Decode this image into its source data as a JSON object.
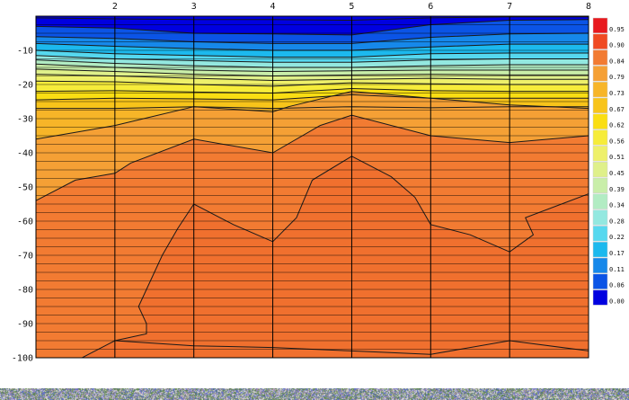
{
  "chart_data": {
    "type": "heatmap",
    "title": "",
    "xlabel": "",
    "ylabel": "",
    "x_ticks": [
      2,
      3,
      4,
      5,
      6,
      7,
      8
    ],
    "y_ticks": [
      -10,
      -20,
      -30,
      -40,
      -50,
      -60,
      -70,
      -80,
      -90,
      -100
    ],
    "xlim": [
      1,
      8
    ],
    "ylim": [
      -100,
      0
    ],
    "grid": true,
    "colorbar": {
      "position": "right",
      "labels": [
        "0.95",
        "0.90",
        "0.84",
        "0.79",
        "0.73",
        "0.67",
        "0.62",
        "0.56",
        "0.51",
        "0.45",
        "0.39",
        "0.34",
        "0.28",
        "0.22",
        "0.17",
        "0.11",
        "0.06",
        "0.00"
      ],
      "colors": [
        "#e8191e",
        "#f04a22",
        "#f27b32",
        "#f5a035",
        "#f7b528",
        "#f8c41a",
        "#fade13",
        "#f6ec3a",
        "#eef06a",
        "#dff08a",
        "#c9eea9",
        "#b2ecc3",
        "#93e8e0",
        "#56d8ef",
        "#1cb9ee",
        "#1688ea",
        "#0b54e6",
        "#0000e0"
      ]
    },
    "bands": [
      {
        "level": 0.0,
        "color": "#0000e0",
        "boundary": [
          [
            1,
            -0.5
          ],
          [
            2,
            -0.8
          ],
          [
            3,
            -1.0
          ],
          [
            4,
            -1.0
          ],
          [
            5,
            -1.2
          ],
          [
            6,
            -0.5
          ],
          [
            7,
            -0.2
          ],
          [
            8,
            -0.2
          ]
        ]
      },
      {
        "level": 0.06,
        "color": "#0b54e6",
        "boundary": [
          [
            1,
            -3
          ],
          [
            2,
            -3.5
          ],
          [
            3,
            -5
          ],
          [
            4,
            -5.2
          ],
          [
            5,
            -5.5
          ],
          [
            6,
            -2.5
          ],
          [
            7,
            -1.2
          ],
          [
            8,
            -1.0
          ]
        ]
      },
      {
        "level": 0.11,
        "color": "#1688ea",
        "boundary": [
          [
            1,
            -6
          ],
          [
            2,
            -6.5
          ],
          [
            3,
            -7.5
          ],
          [
            4,
            -8
          ],
          [
            5,
            -8
          ],
          [
            6,
            -6.2
          ],
          [
            7,
            -5.2
          ],
          [
            8,
            -5.0
          ]
        ]
      },
      {
        "level": 0.17,
        "color": "#1cb9ee",
        "boundary": [
          [
            1,
            -8
          ],
          [
            2,
            -8.8
          ],
          [
            3,
            -9.5
          ],
          [
            4,
            -10
          ],
          [
            5,
            -10
          ],
          [
            6,
            -9
          ],
          [
            7,
            -8.2
          ],
          [
            8,
            -8.2
          ]
        ]
      },
      {
        "level": 0.22,
        "color": "#56d8ef",
        "boundary": [
          [
            1,
            -10
          ],
          [
            2,
            -11
          ],
          [
            3,
            -11.5
          ],
          [
            4,
            -12
          ],
          [
            5,
            -12
          ],
          [
            6,
            -11
          ],
          [
            7,
            -10.8
          ],
          [
            8,
            -10.8
          ]
        ]
      },
      {
        "level": 0.28,
        "color": "#93e8e0",
        "boundary": [
          [
            1,
            -11.5
          ],
          [
            2,
            -12.5
          ],
          [
            3,
            -13
          ],
          [
            4,
            -13.5
          ],
          [
            5,
            -13.5
          ],
          [
            6,
            -12.8
          ],
          [
            7,
            -12.5
          ],
          [
            8,
            -12.5
          ]
        ]
      },
      {
        "level": 0.34,
        "color": "#b2ecc3",
        "boundary": [
          [
            1,
            -12.8
          ],
          [
            2,
            -13.8
          ],
          [
            3,
            -14.5
          ],
          [
            4,
            -15
          ],
          [
            5,
            -15
          ],
          [
            6,
            -14.5
          ],
          [
            7,
            -14.2
          ],
          [
            8,
            -14.2
          ]
        ]
      },
      {
        "level": 0.39,
        "color": "#c9eea9",
        "boundary": [
          [
            1,
            -14
          ],
          [
            2,
            -15
          ],
          [
            3,
            -15.8
          ],
          [
            4,
            -16.2
          ],
          [
            5,
            -16
          ],
          [
            6,
            -15.8
          ],
          [
            7,
            -15.8
          ],
          [
            8,
            -15.8
          ]
        ]
      },
      {
        "level": 0.45,
        "color": "#dff08a",
        "boundary": [
          [
            1,
            -15.5
          ],
          [
            2,
            -16.2
          ],
          [
            3,
            -17
          ],
          [
            4,
            -17.5
          ],
          [
            5,
            -17.2
          ],
          [
            6,
            -17
          ],
          [
            7,
            -17.2
          ],
          [
            8,
            -17.2
          ]
        ]
      },
      {
        "level": 0.51,
        "color": "#eef06a",
        "boundary": [
          [
            1,
            -17
          ],
          [
            2,
            -17.5
          ],
          [
            3,
            -18.2
          ],
          [
            4,
            -18.8
          ],
          [
            5,
            -18.5
          ],
          [
            6,
            -18.2
          ],
          [
            7,
            -18.5
          ],
          [
            8,
            -18.5
          ]
        ]
      },
      {
        "level": 0.56,
        "color": "#f6ec3a",
        "boundary": [
          [
            1,
            -19
          ],
          [
            2,
            -19.2
          ],
          [
            3,
            -20
          ],
          [
            4,
            -20.5
          ],
          [
            5,
            -19.5
          ],
          [
            6,
            -19.8
          ],
          [
            7,
            -20
          ],
          [
            8,
            -20
          ]
        ]
      },
      {
        "level": 0.62,
        "color": "#fade13",
        "boundary": [
          [
            1,
            -22
          ],
          [
            2,
            -21.8
          ],
          [
            3,
            -22.2
          ],
          [
            4,
            -22.5
          ],
          [
            5,
            -21.2
          ],
          [
            6,
            -21.8
          ],
          [
            7,
            -22
          ],
          [
            8,
            -22
          ]
        ]
      },
      {
        "level": 0.67,
        "color": "#f8c41a",
        "boundary": [
          [
            1,
            -24.5
          ],
          [
            2,
            -24
          ],
          [
            3,
            -24.2
          ],
          [
            4,
            -24.5
          ],
          [
            5,
            -23
          ],
          [
            6,
            -24
          ],
          [
            7,
            -24
          ],
          [
            8,
            -24
          ]
        ]
      },
      {
        "level": 0.73,
        "color": "#f7b528",
        "boundary": [
          [
            1,
            -27
          ],
          [
            2,
            -27
          ],
          [
            3,
            -26.5
          ],
          [
            4,
            -27
          ],
          [
            5,
            -26.5
          ],
          [
            6,
            -26.8
          ],
          [
            7,
            -26.5
          ],
          [
            8,
            -26.5
          ]
        ]
      },
      {
        "level": 0.79,
        "color": "#f5a035",
        "boundary": [
          [
            1,
            -36
          ],
          [
            1.5,
            -34
          ],
          [
            2,
            -32
          ],
          [
            3,
            -26.5
          ],
          [
            4,
            -28
          ],
          [
            4.2,
            -26.5
          ],
          [
            5,
            -22
          ],
          [
            6,
            -24
          ],
          [
            7,
            -26
          ],
          [
            8,
            -27
          ]
        ]
      },
      {
        "level": 0.84,
        "color": "#f27b32",
        "boundary": [
          [
            1,
            -54
          ],
          [
            1.5,
            -48
          ],
          [
            2,
            -46
          ],
          [
            2.2,
            -43
          ],
          [
            3,
            -36
          ],
          [
            4,
            -40
          ],
          [
            4.6,
            -32
          ],
          [
            5,
            -29
          ],
          [
            6,
            -35
          ],
          [
            7,
            -37
          ],
          [
            8,
            -35
          ]
        ]
      },
      {
        "level": 0.9,
        "color": "#f0702e",
        "boundary": [
          [
            1.5,
            -101
          ],
          [
            2,
            -95
          ],
          [
            2.4,
            -93
          ],
          [
            2.4,
            -90
          ],
          [
            2.3,
            -85
          ],
          [
            2.4,
            -80
          ],
          [
            2.6,
            -70
          ],
          [
            2.8,
            -62
          ],
          [
            3,
            -55
          ],
          [
            3.5,
            -61
          ],
          [
            4,
            -66
          ],
          [
            4.3,
            -59
          ],
          [
            4.5,
            -48
          ],
          [
            5,
            -41
          ],
          [
            5.5,
            -47
          ],
          [
            5.8,
            -53
          ],
          [
            6,
            -61
          ],
          [
            6.5,
            -64
          ],
          [
            7,
            -69
          ],
          [
            7.3,
            -64
          ],
          [
            7.2,
            -59
          ],
          [
            8,
            -52
          ],
          [
            8,
            -101
          ]
        ]
      }
    ],
    "extra_lines": [
      [
        [
          2,
          -95
        ],
        [
          3,
          -96.5
        ],
        [
          4,
          -97
        ],
        [
          5,
          -98
        ],
        [
          6,
          -99
        ],
        [
          7,
          -95
        ],
        [
          8,
          -98
        ]
      ]
    ]
  }
}
